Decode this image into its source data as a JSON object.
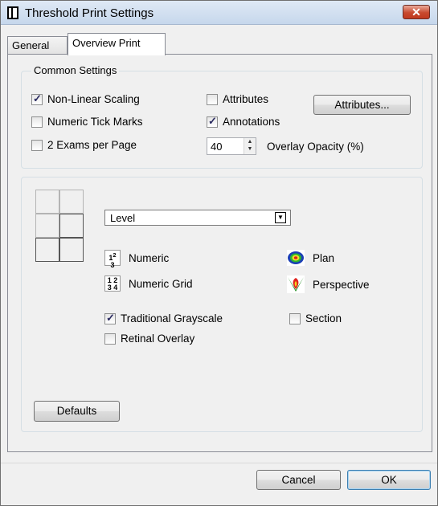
{
  "window": {
    "title": "Threshold Print Settings",
    "close_glyph": "✕"
  },
  "tabs": [
    {
      "label": "General"
    },
    {
      "label": "Overview Print"
    }
  ],
  "common_settings": {
    "label": "Common Settings",
    "non_linear_scaling": {
      "label": "Non-Linear Scaling",
      "checked": true
    },
    "numeric_tick_marks": {
      "label": "Numeric Tick Marks",
      "checked": false
    },
    "two_exams_per_page": {
      "label": "2 Exams per Page",
      "checked": false
    },
    "attributes_check": {
      "label": "Attributes",
      "checked": false
    },
    "annotations": {
      "label": "Annotations",
      "checked": true
    },
    "attributes_button": "Attributes...",
    "overlay_opacity": {
      "value": "40",
      "label": "Overlay Opacity (%)"
    }
  },
  "overview": {
    "dropdown_value": "Level",
    "numeric": {
      "label": "Numeric",
      "icon_text": "1 3 2"
    },
    "numeric_grid": {
      "label": "Numeric Grid",
      "icon_text": "1 2 3 4"
    },
    "plan": {
      "label": "Plan"
    },
    "perspective": {
      "label": "Perspective"
    },
    "traditional_grayscale": {
      "label": "Traditional Grayscale",
      "checked": true
    },
    "retinal_overlay": {
      "label": "Retinal Overlay",
      "checked": false
    },
    "section": {
      "label": "Section",
      "checked": false
    },
    "defaults_button": "Defaults"
  },
  "footer": {
    "cancel": "Cancel",
    "ok": "OK"
  }
}
